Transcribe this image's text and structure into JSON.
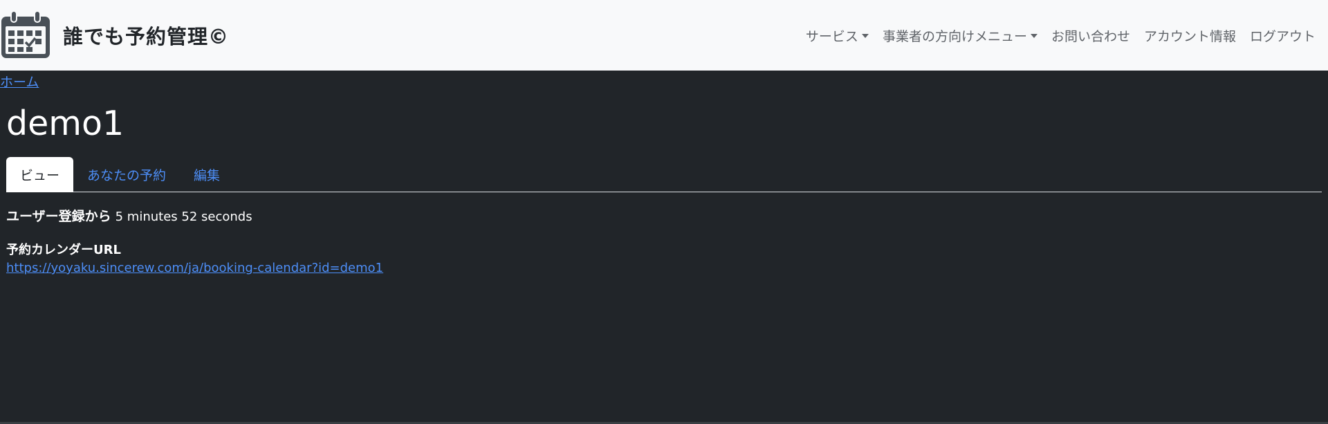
{
  "header": {
    "brand": "誰でも予約管理©",
    "logo_icon": "calendar-check-icon",
    "nav": [
      {
        "label": "サービス",
        "dropdown": true
      },
      {
        "label": "事業者の方向けメニュー",
        "dropdown": true
      },
      {
        "label": "お問い合わせ",
        "dropdown": false
      },
      {
        "label": "アカウント情報",
        "dropdown": false
      },
      {
        "label": "ログアウト",
        "dropdown": false
      }
    ]
  },
  "breadcrumb": {
    "home": "ホーム"
  },
  "page": {
    "title": "demo1",
    "tabs": [
      {
        "label": "ビュー",
        "active": true
      },
      {
        "label": "あなたの予約",
        "active": false
      },
      {
        "label": "編集",
        "active": false
      }
    ],
    "member_for_label": "ユーザー登録から",
    "member_for_value": "5 minutes 52 seconds",
    "calendar_url_label": "予約カレンダーURL",
    "calendar_url": "https://yoyaku.sincerew.com/ja/booking-calendar?id=demo1"
  },
  "colors": {
    "background": "#212529",
    "header_bg": "#f8f9fa",
    "link": "#4d8ef7",
    "text": "#ffffff"
  }
}
